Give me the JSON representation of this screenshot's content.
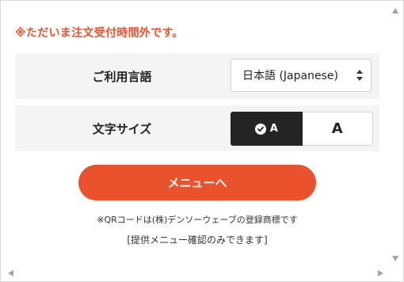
{
  "notice": {
    "text": "※ただいま注文受付時間外です。"
  },
  "language": {
    "label": "ご利用言語",
    "selected": "日本語 (Japanese)"
  },
  "text_size": {
    "label": "文字サイズ",
    "small_label": "A",
    "large_label": "A",
    "selected": "small"
  },
  "menu_button": {
    "label": "メニューへ"
  },
  "footer": {
    "trademark_note": "※QRコードは(株)デンソーウェーブの登録商標です",
    "browse_note": "[提供メニュー確認のみできます]"
  },
  "icons": {
    "select_arrows": "up-down-chevron-icon",
    "selected_check": "check-circle-icon",
    "scroll": [
      "scroll-up-arrow-icon",
      "scroll-down-arrow-icon",
      "scroll-left-arrow-icon",
      "scroll-right-arrow-icon"
    ]
  },
  "colors": {
    "accent": "#e9522d",
    "notice": "#e85530",
    "selected_bg": "#242424",
    "row_bg": "#f4f4f4"
  }
}
